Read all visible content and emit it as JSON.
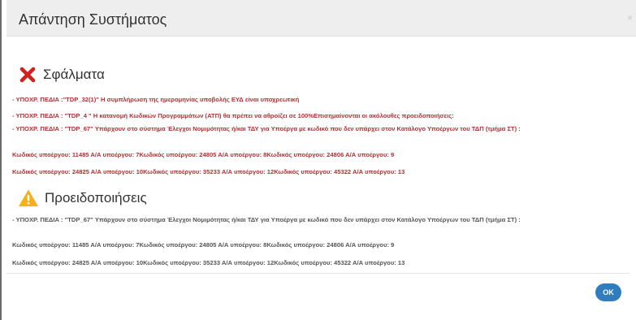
{
  "dialog": {
    "title": "Απάντηση Συστήματος",
    "close_glyph": "×"
  },
  "errors": {
    "heading": "Σφάλματα",
    "icon": "error-x-icon",
    "color": "#b03030",
    "messages": [
      "- ΥΠΟΧΡ. ΠΕΔΙΑ :\"TDP_32(1)\" Η συμπλήρωση της ημερομηνίας υποβολής ΕΥΔ είναι υποχρεωτική",
      "- ΥΠΟΧΡ. ΠΕΔΙΑ : \"TDP_4 \" Η κατανομή Κωδικών Προγραμμάτων (ΑΤΠ) θα πρέπει να αθροίζει σε 100%Επισημαίνονται οι ακόλουθες προειδοποιήσεις:",
      "- ΥΠΟΧΡ. ΠΕΔΙΑ : \"TDP_67\" Υπάρχουν στο σύστημα Έλεγχοι Νομιμότητας ή/και ΤΔΥ για Υποέργα με κωδικό που δεν υπάρχει στον Κατάλογο Υποέργων του ΤΔΠ (τμήμα ΣΤ) :",
      "Κωδικός υποέργου: 11485 Α/Α υποέργου: 7Κωδικός υποέργου: 24805 Α/Α υποέργου: 8Κωδικός υποέργου: 24806 Α/Α υποέργου: 9",
      "Κωδικός υποέργου: 24825 Α/Α υποέργου: 10Κωδικός υποέργου: 35233 Α/Α υποέργου: 12Κωδικός υποέργου: 45322 Α/Α υποέργου: 13"
    ]
  },
  "warnings": {
    "heading": "Προειδοποιήσεις",
    "icon": "warning-triangle-icon",
    "color": "#555555",
    "messages": [
      "- ΥΠΟΧΡ. ΠΕΔΙΑ : \"TDP_67\" Υπάρχουν στο σύστημα Έλεγχοι Νομιμότητας ή/και ΤΔΥ για Υποέργα με κωδικό που δεν υπάρχει στον Κατάλογο Υποέργων του ΤΔΠ (τμήμα ΣΤ) :",
      "Κωδικός υποέργου: 11485 Α/Α υποέργου: 7Κωδικός υποέργου: 24805 Α/Α υποέργου: 8Κωδικός υποέργου: 24806 Α/Α υποέργου: 9",
      "Κωδικός υποέργου: 24825 Α/Α υποέργου: 10Κωδικός υποέργου: 35233 Α/Α υποέργου: 12Κωδικός υποέργου: 45322 Α/Α υποέργου: 13"
    ]
  },
  "footer": {
    "ok_label": "OK",
    "ok_color": "#2f7dbf"
  }
}
